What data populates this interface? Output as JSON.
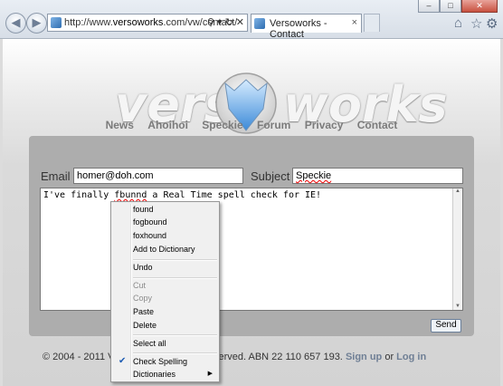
{
  "browser": {
    "address_url_prefix": "http://www.",
    "address_url_domain": "versoworks",
    "address_url_suffix": ".com/vw/contact/",
    "address_icons": [
      "search-icon",
      "dropdown-icon",
      "refresh-icon",
      "close-icon"
    ],
    "tab_title": "Versoworks - Contact",
    "tab_close": "×",
    "window_buttons": [
      "minimize",
      "maximize",
      "close"
    ],
    "toolbar_icons": [
      "home-icon",
      "favorites-star-icon",
      "tools-gear-icon"
    ]
  },
  "site": {
    "logo_left": "verso",
    "logo_right": "works",
    "nav": [
      "News",
      "Ahoihoi",
      "Speckie",
      "Forum",
      "Privacy",
      "Contact"
    ]
  },
  "form": {
    "email_label": "Email :",
    "email_value": "homer@doh.com",
    "subject_label": "Subject :",
    "subject_value": "Speckie",
    "message_before": "I've finally ",
    "message_misspelled": "fbunnd",
    "message_after": " a Real Time spell check for IE!",
    "send_label": "Send"
  },
  "footer": {
    "left": "© 2004 - 2011 Ve",
    "middle": "served. ABN 22 110 657 193.",
    "signup": "Sign up",
    "or": "or",
    "login": "Log in"
  },
  "context_menu": {
    "suggestions": [
      "found",
      "fogbound",
      "foxhound"
    ],
    "add_to_dictionary": "Add to Dictionary",
    "undo": "Undo",
    "cut": "Cut",
    "copy": "Copy",
    "paste": "Paste",
    "delete": "Delete",
    "select_all": "Select all",
    "check_spelling": "Check Spelling",
    "check_spelling_checked": true,
    "dictionaries": "Dictionaries"
  }
}
